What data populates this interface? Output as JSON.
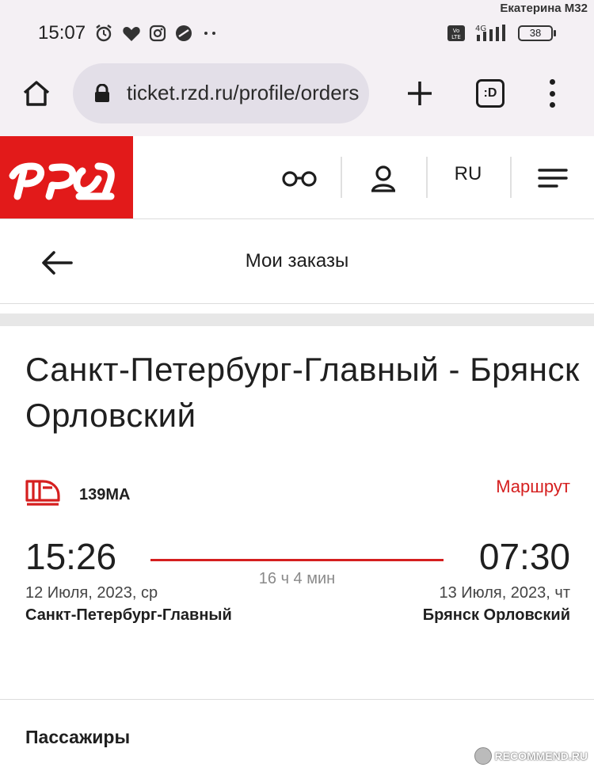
{
  "status_bar": {
    "time": "15:07",
    "battery": "38",
    "network": "4G",
    "volte": "Vo LTE",
    "watermark_user": "Екатерина М32"
  },
  "browser": {
    "url": "ticket.rzd.ru/profile/orders"
  },
  "site_header": {
    "logo": "РЖД",
    "lang": "RU",
    "icons": [
      "glasses-icon",
      "user-icon",
      "hamburger-menu-icon"
    ],
    "brand_color": "#e21a1a"
  },
  "page": {
    "title": "Мои заказы"
  },
  "route": {
    "title": "Санкт-Петербург-Главный - Брянск Орловский",
    "train_number": "139МА",
    "route_link": "Маршрут",
    "departure": {
      "time": "15:26",
      "date": "12 Июля, 2023, ср",
      "station": "Санкт-Петербург-Главный"
    },
    "arrival": {
      "time": "07:30",
      "date": "13 Июля, 2023, чт",
      "station": "Брянск Орловский"
    },
    "duration": "16 ч 4 мин",
    "accent_color": "#d51f1f"
  },
  "passengers": {
    "heading": "Пассажиры"
  },
  "watermark": "RECOMMEND.RU"
}
